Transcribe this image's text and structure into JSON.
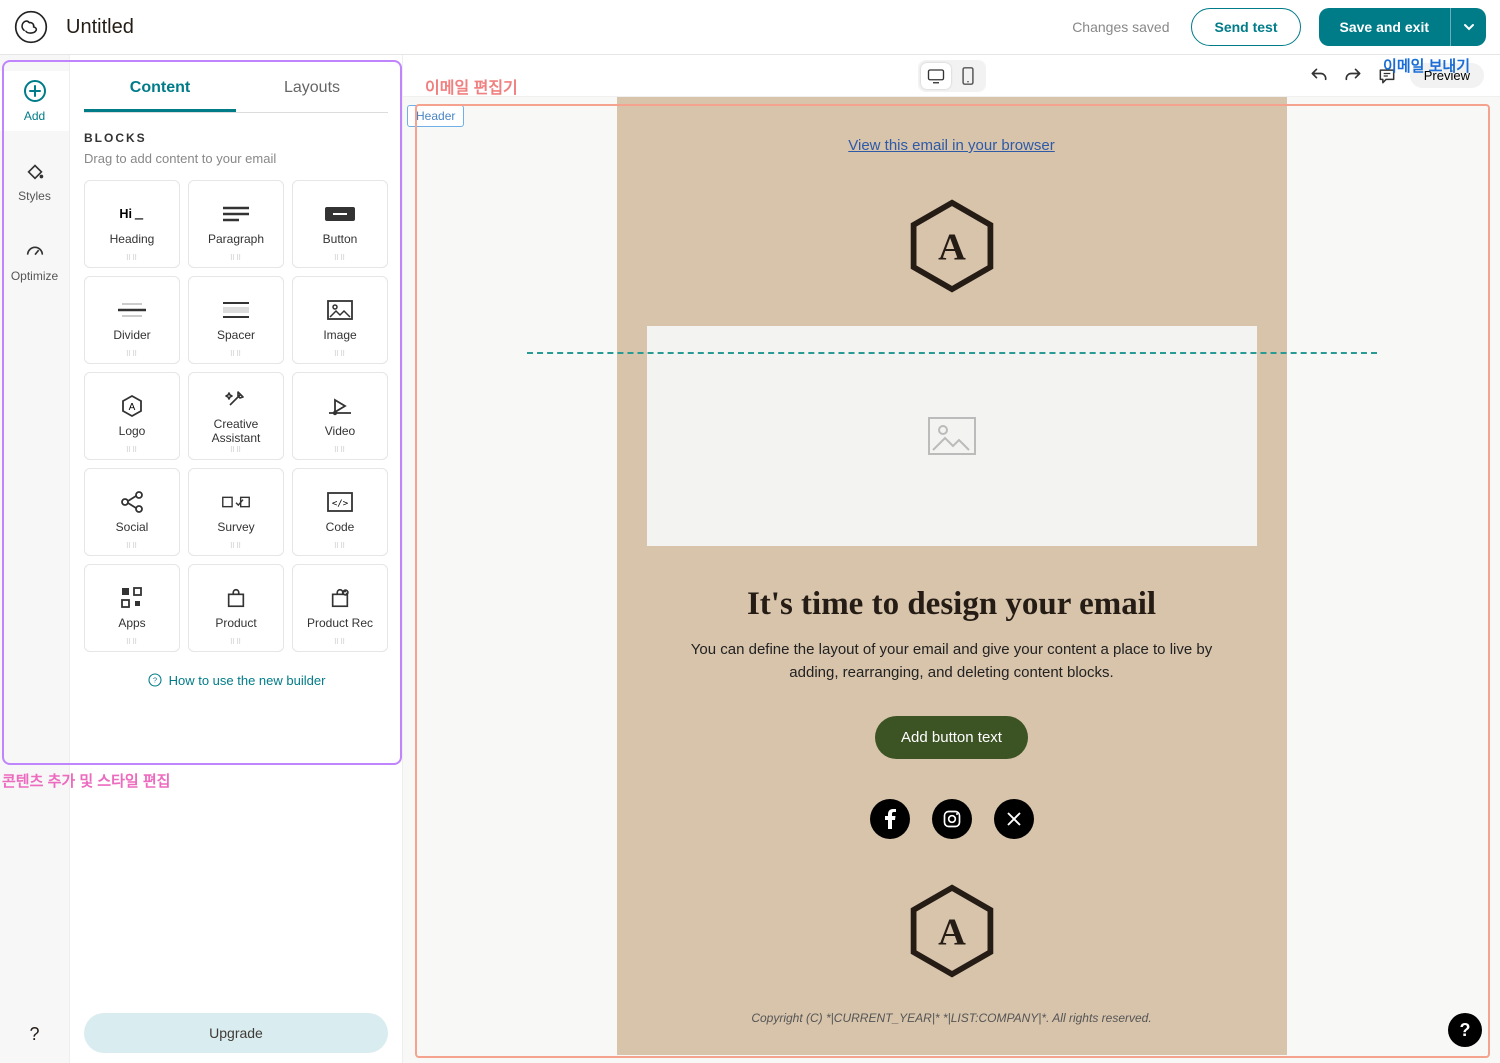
{
  "header": {
    "title": "Untitled",
    "saved_status": "Changes saved",
    "send_test_label": "Send test",
    "save_exit_label": "Save and exit"
  },
  "annotations": {
    "send_email": "이메일 보내기",
    "email_editor": "이메일 편집기",
    "content_add": "콘텐츠 추가 및 스타일 편집"
  },
  "vtabs": {
    "add": "Add",
    "styles": "Styles",
    "optimize": "Optimize"
  },
  "panel": {
    "tab_content": "Content",
    "tab_layouts": "Layouts",
    "blocks_heading": "BLOCKS",
    "blocks_sub": "Drag to add content to your email",
    "blocks": [
      {
        "label": "Heading",
        "icon": "heading-icon"
      },
      {
        "label": "Paragraph",
        "icon": "paragraph-icon"
      },
      {
        "label": "Button",
        "icon": "button-icon"
      },
      {
        "label": "Divider",
        "icon": "divider-icon"
      },
      {
        "label": "Spacer",
        "icon": "spacer-icon"
      },
      {
        "label": "Image",
        "icon": "image-icon"
      },
      {
        "label": "Logo",
        "icon": "logo-icon"
      },
      {
        "label": "Creative\nAssistant",
        "icon": "creative-icon"
      },
      {
        "label": "Video",
        "icon": "video-icon"
      },
      {
        "label": "Social",
        "icon": "social-icon"
      },
      {
        "label": "Survey",
        "icon": "survey-icon"
      },
      {
        "label": "Code",
        "icon": "code-icon"
      },
      {
        "label": "Apps",
        "icon": "apps-icon"
      },
      {
        "label": "Product",
        "icon": "product-icon"
      },
      {
        "label": "Product Rec",
        "icon": "productrec-icon"
      }
    ],
    "howto": "How to use the new builder",
    "upgrade": "Upgrade"
  },
  "canvas_controls": {
    "preview": "Preview"
  },
  "email": {
    "header_tag": "Header",
    "view_browser": "View this email in your browser",
    "title": "It's time to design your email",
    "body": "You can define the layout of your email and give your content a place to live by adding, rearranging, and deleting content blocks.",
    "button": "Add button text",
    "footer": "Copyright (C) *|CURRENT_YEAR|* *|LIST:COMPANY|*. All rights reserved."
  },
  "help_glyph": "?"
}
